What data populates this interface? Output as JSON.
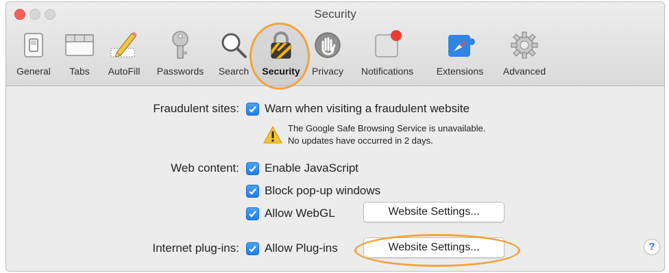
{
  "window": {
    "title": "Security"
  },
  "toolbar": {
    "items": [
      {
        "label": "General",
        "icon": "general-switch-icon"
      },
      {
        "label": "Tabs",
        "icon": "tabs-icon"
      },
      {
        "label": "AutoFill",
        "icon": "autofill-pencil-icon"
      },
      {
        "label": "Passwords",
        "icon": "key-icon"
      },
      {
        "label": "Search",
        "icon": "magnifier-icon"
      },
      {
        "label": "Security",
        "icon": "padlock-icon",
        "selected": true
      },
      {
        "label": "Privacy",
        "icon": "hand-icon"
      },
      {
        "label": "Notifications",
        "icon": "notification-badge-icon"
      },
      {
        "label": "Extensions",
        "icon": "puzzle-compass-icon"
      },
      {
        "label": "Advanced",
        "icon": "gear-icon"
      }
    ]
  },
  "fraud": {
    "label": "Fraudulent sites:",
    "option": "Warn when visiting a fraudulent website",
    "warning_line1": "The Google Safe Browsing Service is unavailable.",
    "warning_line2": "No updates have occurred in 2 days."
  },
  "web": {
    "label": "Web content:",
    "js": "Enable JavaScript",
    "popups": "Block pop-up windows",
    "webgl": "Allow WebGL",
    "webgl_button": "Website Settings..."
  },
  "plugins": {
    "label": "Internet plug-ins:",
    "option": "Allow Plug-ins",
    "button": "Website Settings..."
  },
  "help": {
    "label": "?"
  },
  "colors": {
    "accent_highlight": "#f2a33a",
    "checkbox": "#1f7ee8",
    "close": "#fc605c"
  }
}
